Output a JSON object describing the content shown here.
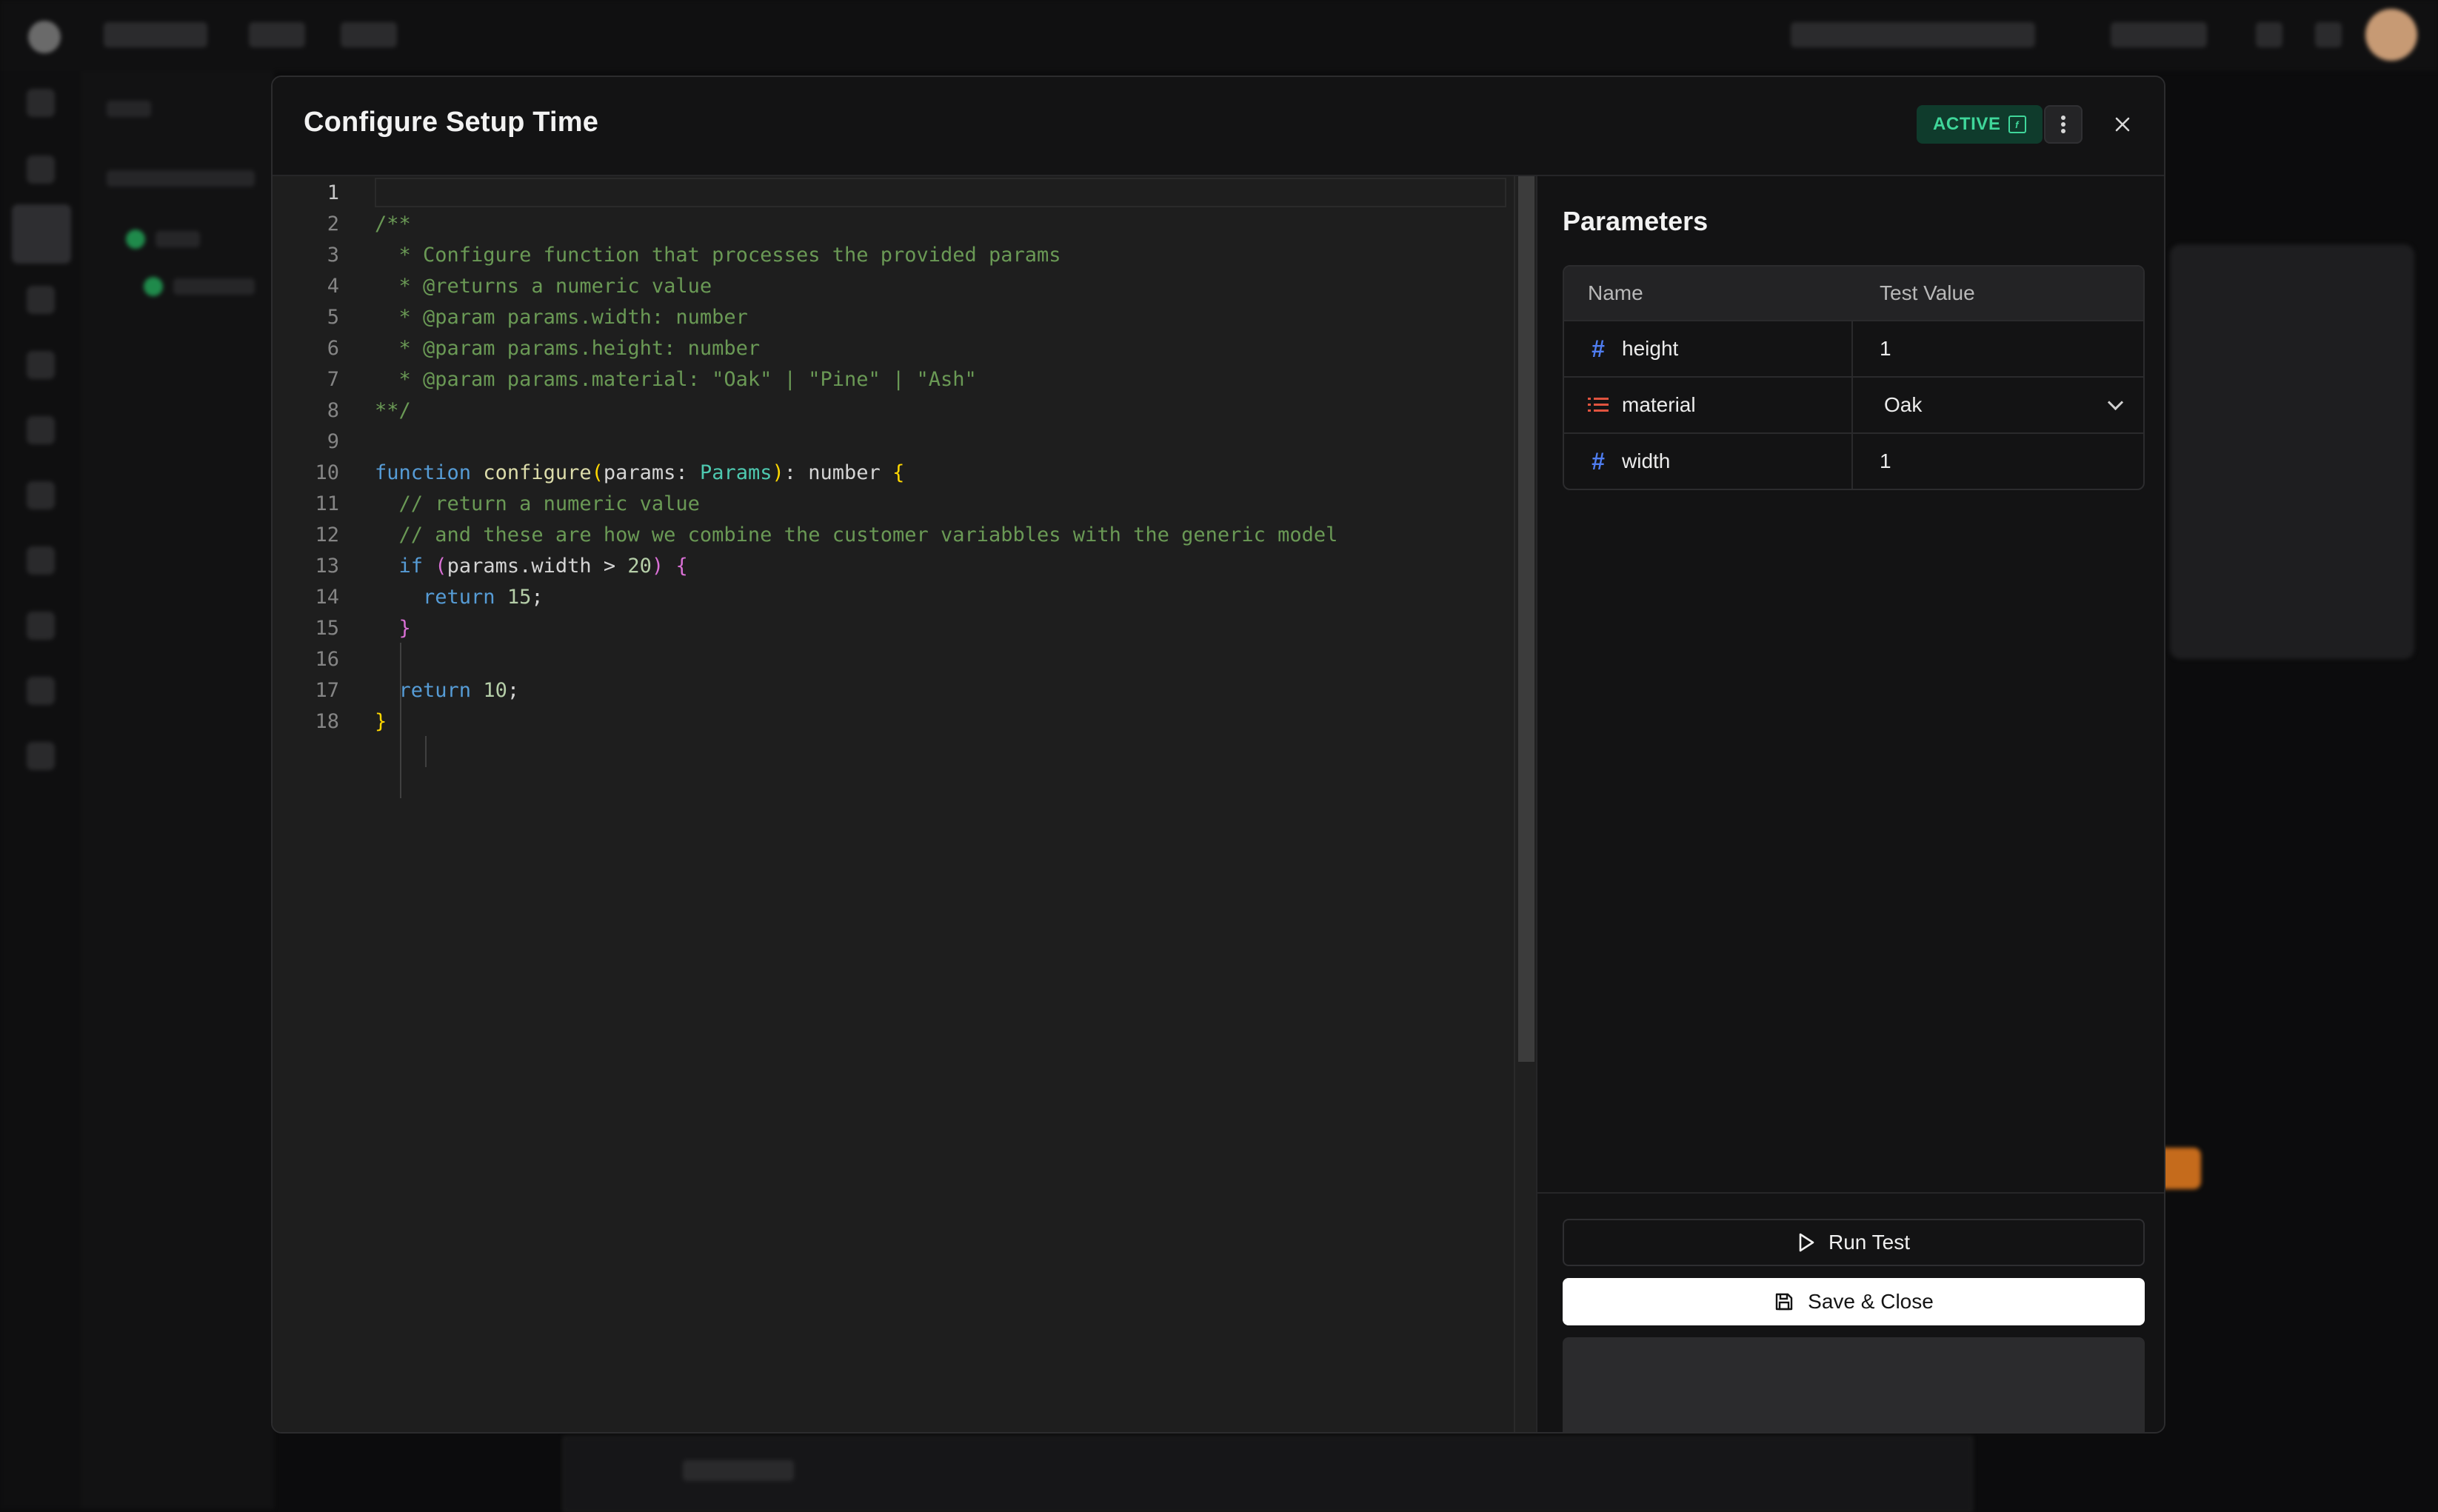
{
  "modal": {
    "title": "Configure Setup Time",
    "status_badge": "ACTIVE"
  },
  "editor": {
    "line_numbers": [
      "1",
      "2",
      "3",
      "4",
      "5",
      "6",
      "7",
      "8",
      "9",
      "10",
      "11",
      "12",
      "13",
      "14",
      "15",
      "16",
      "17",
      "18"
    ],
    "lines": [
      "",
      "/**",
      "  * Configure function that processes the provided params",
      "  * @returns a numeric value",
      "  * @param params.width: number",
      "  * @param params.height: number",
      "  * @param params.material: \"Oak\" | \"Pine\" | \"Ash\"",
      "**/",
      "",
      "function configure(params: Params): number {",
      "  // return a numeric value",
      "  // and these are how we combine the customer variabbles with the generic model",
      "  if (params.width > 20) {",
      "    return 15;",
      "  }",
      "",
      "  return 10;",
      "}"
    ]
  },
  "parameters": {
    "title": "Parameters",
    "columns": {
      "name": "Name",
      "test_value": "Test Value"
    },
    "rows": [
      {
        "name": "height",
        "value": "1",
        "type_icon": "hash-icon"
      },
      {
        "name": "material",
        "value": "Oak",
        "type_icon": "list-icon"
      },
      {
        "name": "width",
        "value": "1",
        "type_icon": "hash-icon"
      }
    ]
  },
  "actions": {
    "run_test": "Run Test",
    "save_close": "Save & Close"
  },
  "colors": {
    "badge_bg": "#0f3b2c",
    "badge_text": "#3fd69a",
    "comment": "#6a9955",
    "keyword": "#569cd6",
    "number_icon": "#4f7df0",
    "enum_icon": "#e0533f"
  }
}
